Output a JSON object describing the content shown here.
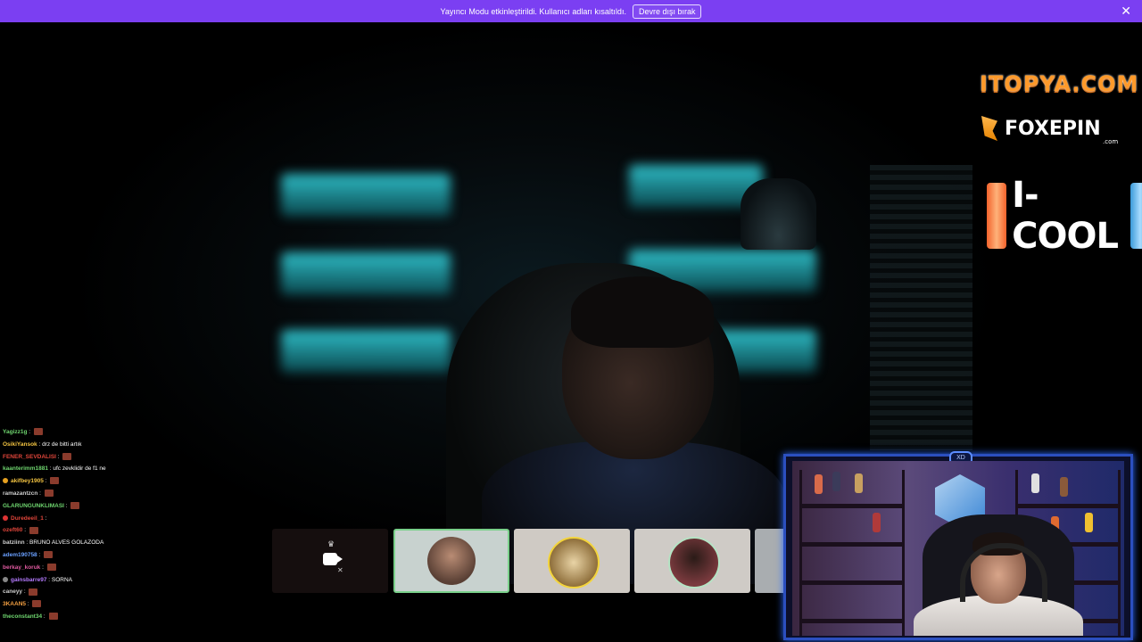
{
  "banner": {
    "message": "Yayıncı Modu etkinleştirildi. Kullanıcı adları kısaltıldı.",
    "button_label": "Devre dışı bırak",
    "close_glyph": "✕",
    "bg_color": "#7b3ff2"
  },
  "sponsors": {
    "itopya": "ITOPYA.COM",
    "foxepin": "FOXEPIN",
    "foxepin_suffix": ".com",
    "icool": "I-COOL",
    "can_label": "I-COOL"
  },
  "chat": {
    "messages": [
      {
        "user": "Yagizz1g",
        "text": "",
        "color": "#6fd66f",
        "emote": true
      },
      {
        "user": "OsikiYansok",
        "text": "drz de bitti artık",
        "color": "#f5c542",
        "emote": false
      },
      {
        "user": "FENER_SEVDALISI",
        "text": "",
        "color": "#e0453a",
        "emote": true
      },
      {
        "user": "kaanterimm1881",
        "text": "ufc zevklidir de f1 ne",
        "color": "#6fd66f",
        "emote": false
      },
      {
        "user": "akifbey1905",
        "text": "",
        "color": "#f5c542",
        "emote": true,
        "badge": "#e6a020"
      },
      {
        "user": "ramazantzcn",
        "text": "",
        "color": "#cfcfcf",
        "emote": true
      },
      {
        "user": "GLARUNGUNKLIMASI",
        "text": "",
        "color": "#6fd66f",
        "emote": true
      },
      {
        "user": "Duredeeil_1",
        "text": "",
        "color": "#e0453a",
        "emote": false,
        "badge": "#d33"
      },
      {
        "user": "ozeft60",
        "text": "",
        "color": "#e0453a",
        "emote": true
      },
      {
        "user": "batziinn",
        "text": "BRUNO ALVES GOLAZODA",
        "color": "#cfcfcf",
        "emote": false
      },
      {
        "user": "adem190758",
        "text": "",
        "color": "#6aa0ff",
        "emote": true
      },
      {
        "user": "berkay_koruk",
        "text": "",
        "color": "#e05aa0",
        "emote": true
      },
      {
        "user": "gainsbarre97",
        "text": "SORNA",
        "color": "#b57bff",
        "emote": false,
        "badge": "#888"
      },
      {
        "user": "caneyy",
        "text": "",
        "color": "#cfcfcf",
        "emote": true
      },
      {
        "user": "3KAAN5",
        "text": "",
        "color": "#f5a142",
        "emote": true
      },
      {
        "user": "theconstant34",
        "text": "",
        "color": "#6fd66f",
        "emote": true
      }
    ]
  },
  "tiles": [
    {
      "name": "participant-muted",
      "icon": "camera-off-icon"
    },
    {
      "name": "participant-1"
    },
    {
      "name": "participant-2"
    },
    {
      "name": "participant-3"
    },
    {
      "name": "participant-4"
    }
  ],
  "webcam": {
    "tag": "XD",
    "accent_color": "#2b4fbf"
  }
}
